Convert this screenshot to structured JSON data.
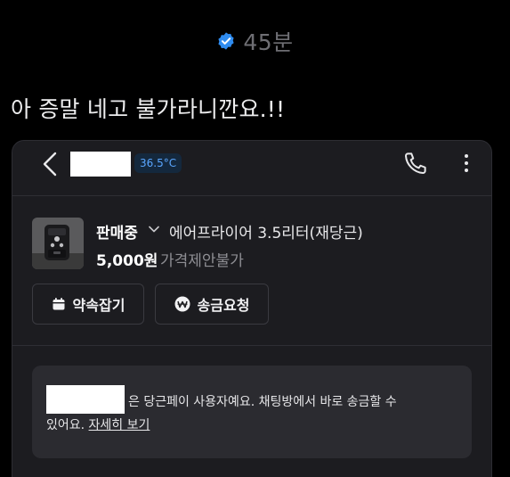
{
  "meta": {
    "time_ago": "45분",
    "verified_icon": "verified-check-icon",
    "accent": "#2f8cf0"
  },
  "post": {
    "text": "아 증말 네고 불가라니깐요.!!"
  },
  "chat_screen": {
    "header": {
      "back_icon": "chevron-left-icon",
      "temperature": "36.5°C",
      "phone_icon": "phone-icon",
      "more_icon": "more-vertical-icon"
    },
    "product": {
      "status": "판매중",
      "title": "에어프라이어 3.5리터(재당근)",
      "price": "5,000원",
      "negotiation": "가격제안불가"
    },
    "actions": {
      "appointment_label": "약속잡기",
      "remit_label": "송금요청"
    },
    "notice": {
      "line1": "은 당근페이 사용자예요. 채팅방에서 바로 송금할 수",
      "line2_prefix": "있어요.",
      "link_label": "자세히 보기"
    }
  }
}
